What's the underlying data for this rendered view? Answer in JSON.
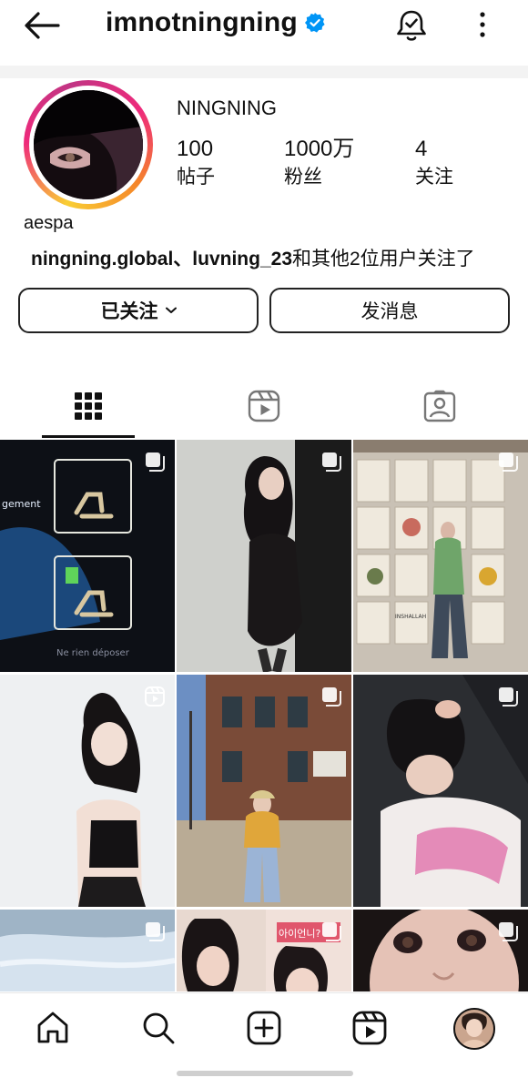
{
  "header": {
    "username": "imnotningning",
    "icons": {
      "back": "arrow-left-icon",
      "verified": "verified-badge-icon",
      "notifications": "bell-check-icon",
      "more": "more-vertical-icon"
    },
    "accent": "#0095f6"
  },
  "profile": {
    "display_name": "NINGNING",
    "stats": [
      {
        "value": "100",
        "label": "帖子"
      },
      {
        "value": "1000万",
        "label": "粉丝"
      },
      {
        "value": "4",
        "label": "关注"
      }
    ],
    "bio": "aespa",
    "followed_by": {
      "users": "ningning.global、luvning_23",
      "rest": "和其他2位用户关注了"
    }
  },
  "actions": {
    "following_label": "已关注",
    "message_label": "发消息"
  },
  "tabs": [
    {
      "name": "grid",
      "icon": "grid-icon",
      "active": true
    },
    {
      "name": "reels",
      "icon": "reels-icon",
      "active": false
    },
    {
      "name": "tagged",
      "icon": "tagged-user-icon",
      "active": false
    }
  ],
  "posts": [
    {
      "type": "carousel",
      "icon": "carousel-icon"
    },
    {
      "type": "carousel",
      "icon": "carousel-icon"
    },
    {
      "type": "carousel",
      "icon": "carousel-icon"
    },
    {
      "type": "reel",
      "icon": "reel-icon"
    },
    {
      "type": "carousel",
      "icon": "carousel-icon"
    },
    {
      "type": "carousel",
      "icon": "carousel-icon"
    },
    {
      "type": "carousel",
      "icon": "carousel-icon"
    },
    {
      "type": "carousel",
      "icon": "carousel-icon"
    },
    {
      "type": "carousel",
      "icon": "carousel-icon"
    }
  ],
  "post_text": {
    "p1_left": "gement",
    "p1_bottom": "Ne rien déposer",
    "p3_tote": "INSHALLAH",
    "p8_sign": "아이언니?"
  },
  "bottom_nav": [
    {
      "name": "home",
      "icon": "home-icon"
    },
    {
      "name": "search",
      "icon": "search-icon"
    },
    {
      "name": "create",
      "icon": "plus-square-icon"
    },
    {
      "name": "reels",
      "icon": "reels-icon"
    },
    {
      "name": "profile",
      "icon": "profile-avatar"
    }
  ]
}
